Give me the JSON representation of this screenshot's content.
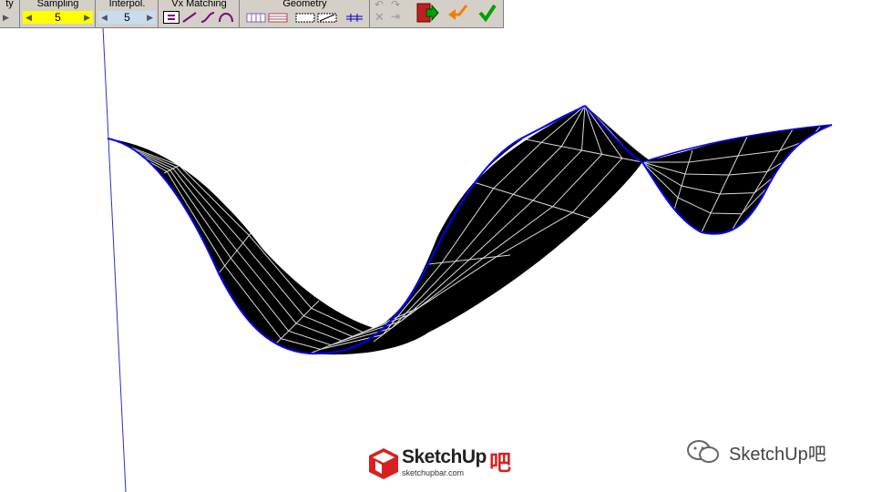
{
  "toolbar": {
    "group0": {
      "title": "ty"
    },
    "sampling": {
      "title": "Sampling",
      "value": "5"
    },
    "interpol": {
      "title": "Interpol.",
      "value": "5"
    },
    "vx_matching": {
      "title": "Vx Matching"
    },
    "geometry": {
      "title": "Geometry"
    }
  },
  "logo": {
    "brand": "SketchUp",
    "ba": "吧",
    "url": "sketchupbar.com"
  },
  "watermark": {
    "text": "SketchUp吧"
  },
  "colors": {
    "surface": "#000000",
    "grid": "#ffffff",
    "edge": "#0000ff",
    "toolbar_bg": "#d4d0c8",
    "sampling_bg": "#ffff00"
  }
}
